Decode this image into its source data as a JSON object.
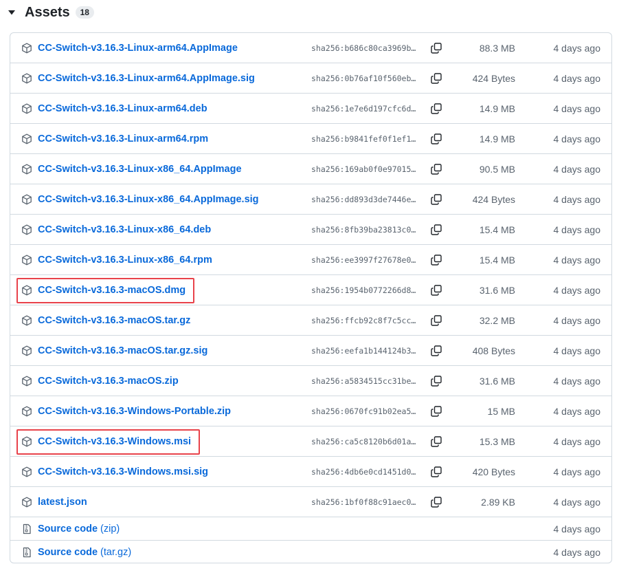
{
  "header": {
    "title": "Assets",
    "count": "18",
    "caret_icon": "triangle-down-icon"
  },
  "assets": [
    {
      "name": "CC-Switch-v3.16.3-Linux-arm64.AppImage",
      "sha": "sha256:b686c80ca3969b…",
      "size": "88.3 MB",
      "date": "4 days ago"
    },
    {
      "name": "CC-Switch-v3.16.3-Linux-arm64.AppImage.sig",
      "sha": "sha256:0b76af10f560eb…",
      "size": "424 Bytes",
      "date": "4 days ago"
    },
    {
      "name": "CC-Switch-v3.16.3-Linux-arm64.deb",
      "sha": "sha256:1e7e6d197cfc6d…",
      "size": "14.9 MB",
      "date": "4 days ago"
    },
    {
      "name": "CC-Switch-v3.16.3-Linux-arm64.rpm",
      "sha": "sha256:b9841fef0f1ef1…",
      "size": "14.9 MB",
      "date": "4 days ago"
    },
    {
      "name": "CC-Switch-v3.16.3-Linux-x86_64.AppImage",
      "sha": "sha256:169ab0f0e97015…",
      "size": "90.5 MB",
      "date": "4 days ago"
    },
    {
      "name": "CC-Switch-v3.16.3-Linux-x86_64.AppImage.sig",
      "sha": "sha256:dd893d3de7446e…",
      "size": "424 Bytes",
      "date": "4 days ago"
    },
    {
      "name": "CC-Switch-v3.16.3-Linux-x86_64.deb",
      "sha": "sha256:8fb39ba23813c0…",
      "size": "15.4 MB",
      "date": "4 days ago"
    },
    {
      "name": "CC-Switch-v3.16.3-Linux-x86_64.rpm",
      "sha": "sha256:ee3997f27678e0…",
      "size": "15.4 MB",
      "date": "4 days ago"
    },
    {
      "name": "CC-Switch-v3.16.3-macOS.dmg",
      "sha": "sha256:1954b0772266d8…",
      "size": "31.6 MB",
      "date": "4 days ago"
    },
    {
      "name": "CC-Switch-v3.16.3-macOS.tar.gz",
      "sha": "sha256:ffcb92c8f7c5cc…",
      "size": "32.2 MB",
      "date": "4 days ago"
    },
    {
      "name": "CC-Switch-v3.16.3-macOS.tar.gz.sig",
      "sha": "sha256:eefa1b144124b3…",
      "size": "408 Bytes",
      "date": "4 days ago"
    },
    {
      "name": "CC-Switch-v3.16.3-macOS.zip",
      "sha": "sha256:a5834515cc31be…",
      "size": "31.6 MB",
      "date": "4 days ago"
    },
    {
      "name": "CC-Switch-v3.16.3-Windows-Portable.zip",
      "sha": "sha256:0670fc91b02ea5…",
      "size": "15 MB",
      "date": "4 days ago"
    },
    {
      "name": "CC-Switch-v3.16.3-Windows.msi",
      "sha": "sha256:ca5c8120b6d01a…",
      "size": "15.3 MB",
      "date": "4 days ago"
    },
    {
      "name": "CC-Switch-v3.16.3-Windows.msi.sig",
      "sha": "sha256:4db6e0cd1451d0…",
      "size": "420 Bytes",
      "date": "4 days ago"
    },
    {
      "name": "latest.json",
      "sha": "sha256:1bf0f88c91aec0…",
      "size": "2.89 KB",
      "date": "4 days ago"
    }
  ],
  "source_code": [
    {
      "label": "Source code",
      "suffix": "(zip)",
      "date": "4 days ago"
    },
    {
      "label": "Source code",
      "suffix": "(tar.gz)",
      "date": "4 days ago"
    }
  ],
  "colors": {
    "link": "#0969da",
    "muted": "#59636e",
    "border": "#d1d9e0",
    "highlight": "#e8424a"
  }
}
